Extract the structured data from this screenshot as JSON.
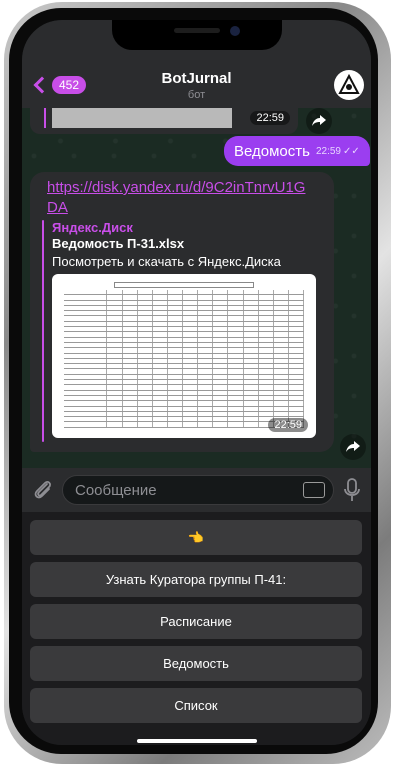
{
  "header": {
    "back_count": "452",
    "title": "BotJurnal",
    "subtitle": "бот"
  },
  "messages": {
    "previous": {
      "time": "22:59"
    },
    "outgoing": {
      "text": "Ведомость",
      "time": "22:59"
    },
    "incoming": {
      "link": "https://disk.yandex.ru/d/9C2inTnrvU1GDA",
      "preview_site": "Яндекс.Диск",
      "preview_title": "Ведомость П-31.xlsx",
      "preview_desc": "Посмотреть и скачать с Яндекс.Диска",
      "time": "22:59"
    }
  },
  "composer": {
    "placeholder": "Сообщение"
  },
  "keyboard": {
    "buttons": [
      {
        "label": "👈"
      },
      {
        "label": "Узнать Куратора группы П-41:"
      },
      {
        "label": "Расписание"
      },
      {
        "label": "Ведомость"
      },
      {
        "label": "Список"
      }
    ]
  },
  "colors": {
    "accent": "#c84ee8",
    "outgoing_bubble": "#9b3ef0",
    "incoming_bubble": "#2b2c2e",
    "keyboard_button": "#3a3a3c"
  }
}
